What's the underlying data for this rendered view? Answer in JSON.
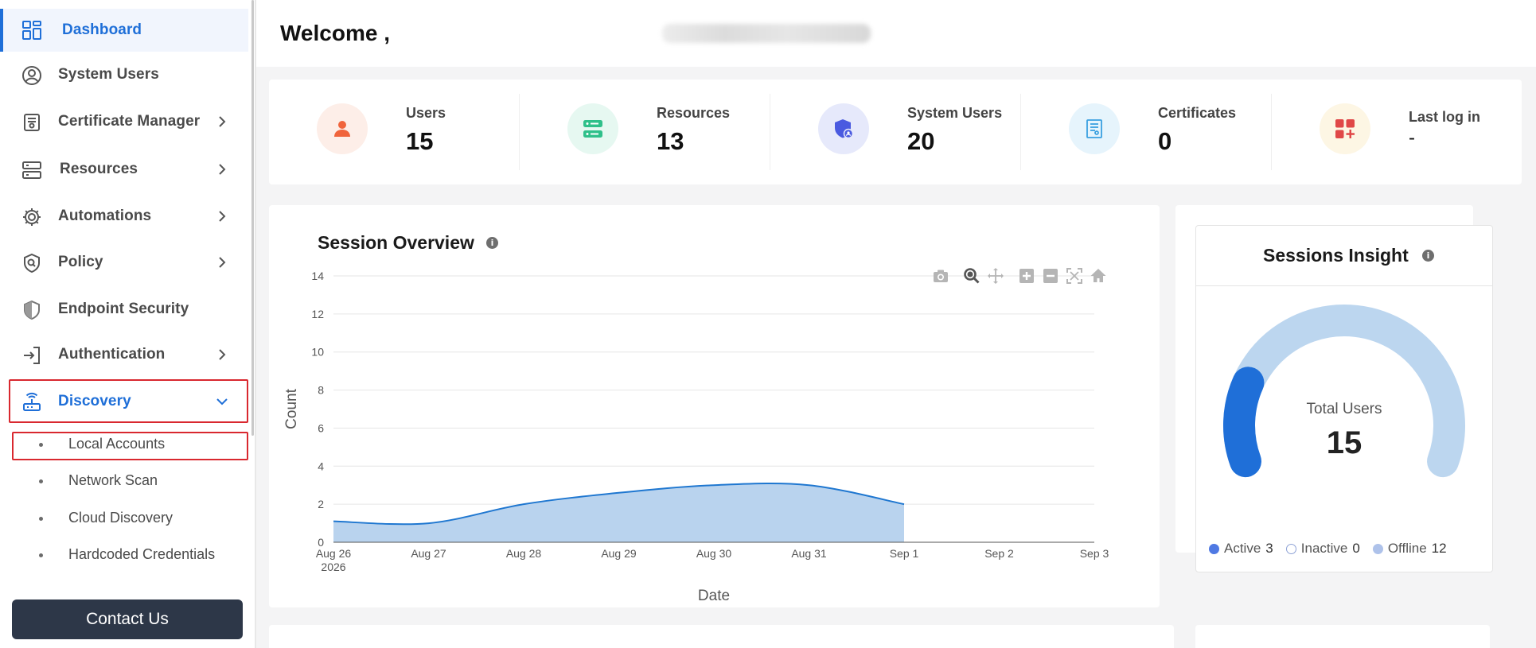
{
  "sidebar": {
    "items": [
      {
        "label": "Dashboard",
        "icon": "dashboard-grid-icon",
        "active": true
      },
      {
        "label": "System Users",
        "icon": "user-circle-icon"
      },
      {
        "label": "Certificate Manager",
        "icon": "certificate-icon",
        "chevron": "right"
      },
      {
        "label": "Resources",
        "icon": "server-icon",
        "chevron": "right"
      },
      {
        "label": "Automations",
        "icon": "gear-icon",
        "chevron": "right"
      },
      {
        "label": "Policy",
        "icon": "policy-shield-icon",
        "chevron": "right"
      },
      {
        "label": "Endpoint Security",
        "icon": "shield-icon"
      },
      {
        "label": "Authentication",
        "icon": "login-arrow-icon",
        "chevron": "right"
      },
      {
        "label": "Discovery",
        "icon": "router-icon",
        "chevron": "down",
        "open": true
      }
    ],
    "sub_items": [
      {
        "label": "Local Accounts"
      },
      {
        "label": "Network Scan"
      },
      {
        "label": "Cloud Discovery"
      },
      {
        "label": "Hardcoded Credentials"
      }
    ],
    "contact_label": "Contact Us"
  },
  "header": {
    "welcome": "Welcome ,"
  },
  "stats": [
    {
      "label": "Users",
      "value": "15",
      "icon": "user-icon",
      "bg": "#fdeee8",
      "fg": "#f0643c"
    },
    {
      "label": "Resources",
      "value": "13",
      "icon": "server-stack-icon",
      "bg": "#e6f8f1",
      "fg": "#2fc08a"
    },
    {
      "label": "System Users",
      "value": "20",
      "icon": "shield-user-icon",
      "bg": "#e6e9fb",
      "fg": "#4a5ae0"
    },
    {
      "label": "Certificates",
      "value": "0",
      "icon": "certificate-doc-icon",
      "bg": "#e6f4fc",
      "fg": "#3aa0e0"
    },
    {
      "label": "Last log in",
      "value": "-",
      "icon": "apps-add-icon",
      "bg": "#fdf6e4",
      "fg": "#e04848"
    }
  ],
  "session_overview": {
    "title": "Session Overview",
    "info": "i",
    "toolbar": [
      "camera-icon",
      "zoom-icon",
      "pan-icon",
      "zoom-in-icon",
      "zoom-out-icon",
      "autoscale-icon",
      "home-icon"
    ]
  },
  "chart_data": {
    "type": "area",
    "x": [
      "Aug 26",
      "Aug 27",
      "Aug 28",
      "Aug 29",
      "Aug 30",
      "Aug 31",
      "Sep 1",
      "Sep 2",
      "Sep 3"
    ],
    "x_extra_label": "2026",
    "series": [
      {
        "values": [
          1.1,
          1.0,
          2.0,
          2.6,
          3.0,
          3.0,
          2.0,
          null,
          null
        ],
        "color": "#1f77d0",
        "fill": "#b9d3ee"
      }
    ],
    "xlabel": "Date",
    "ylabel": "Count",
    "ylim": [
      0,
      14
    ],
    "yticks": [
      0,
      2,
      4,
      6,
      8,
      10,
      12,
      14
    ],
    "grid": true
  },
  "sessions_insight": {
    "title": "Sessions Insight",
    "info": "i",
    "gauge_label": "Total Users",
    "gauge_value": "15",
    "total": 15,
    "active_fraction": 0.2,
    "legend": [
      {
        "label": "Active",
        "count": "3",
        "color": "#4f79e3",
        "fill": true
      },
      {
        "label": "Inactive",
        "count": "0",
        "color": "#8ea2d6",
        "fill": false
      },
      {
        "label": "Offline",
        "count": "12",
        "color": "#aec2ea",
        "fill": true
      }
    ],
    "colors": {
      "active": "#1f6fd8",
      "offline": "#bcd6ef"
    }
  }
}
